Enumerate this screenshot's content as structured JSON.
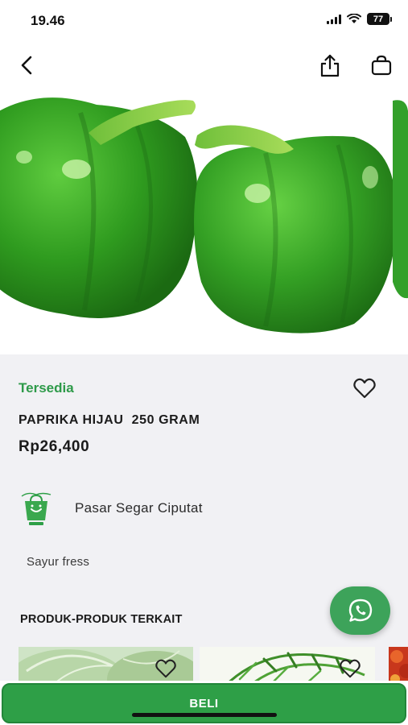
{
  "status_bar": {
    "time": "19.46",
    "battery": "77"
  },
  "nav": {
    "back_icon": "chevron-left-icon",
    "share_icon": "share-icon",
    "cart_icon": "shopping-bag-icon"
  },
  "product": {
    "availability": "Tersedia",
    "title": "PAPRIKA HIJAU  250 GRAM",
    "price": "Rp26,400",
    "wishlist_icon": "heart-outline-icon",
    "description": "Sayur fress"
  },
  "seller": {
    "name": "Pasar Segar Ciputat",
    "logo_icon": "seller-bag-logo"
  },
  "related": {
    "heading": "PRODUK-PRODUK TERKAIT",
    "items": [
      {
        "image": "cabbage",
        "fav_icon": "heart-outline-icon"
      },
      {
        "image": "green-leaves",
        "fav_icon": "heart-outline-icon"
      },
      {
        "image": "red-vegetables"
      }
    ]
  },
  "whatsapp_icon": "whatsapp-icon",
  "buy_button": {
    "label": "BELI"
  },
  "colors": {
    "brand_green": "#2e9f47",
    "availability_green": "#2e9a49",
    "page_background": "#f1f1f4"
  }
}
